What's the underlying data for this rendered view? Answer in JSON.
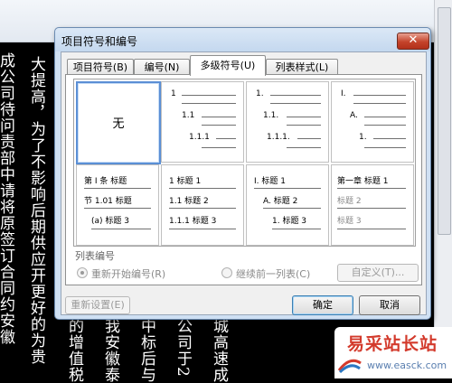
{
  "background": {
    "columns_left": [
      "成公司待问责部中请将原签订合同约安徽",
      "大提高，为了不影响后期供应开更好的为贵"
    ],
    "columns_bottom": [
      "的增值税",
      "我安徽泰",
      "中标后与",
      "公司于2",
      "城高速成"
    ]
  },
  "watermark": {
    "text": "易采站长站",
    "url": "www.easck.com"
  },
  "dialog": {
    "title": "项目符号和编号",
    "close_label": "✕",
    "tabs": [
      {
        "label": "项目符号(B)"
      },
      {
        "label": "编号(N)"
      },
      {
        "label": "多级符号(U)"
      },
      {
        "label": "列表样式(L)"
      }
    ],
    "gallery": {
      "none_label": "无",
      "cells": [
        {
          "lines": [
            "1",
            "1.1",
            "1.1.1"
          ]
        },
        {
          "lines": [
            "1.",
            "1.1.",
            "1.1.1."
          ]
        },
        {
          "lines": [
            "I.",
            "A.",
            "1."
          ]
        },
        {
          "lines": [
            "第 I 条 标题",
            "节 1.01 标题",
            "(a) 标题 3"
          ]
        },
        {
          "lines": [
            "1 标题 1",
            "1.1 标题 2",
            "1.1.1 标题 3"
          ]
        },
        {
          "lines": [
            "I. 标题 1",
            "A. 标题 2",
            "1. 标题 3"
          ]
        },
        {
          "lines": [
            "第一章 标题 1",
            "标题 2",
            "标题 3"
          ]
        }
      ]
    },
    "list_numbering_label": "列表编号",
    "restart_label": "重新开始编号(R)",
    "continue_label": "继续前一列表(C)",
    "customize_label": "自定义(T)...",
    "reset_label": "重新设置(E)",
    "ok_label": "确定",
    "cancel_label": "取消"
  }
}
